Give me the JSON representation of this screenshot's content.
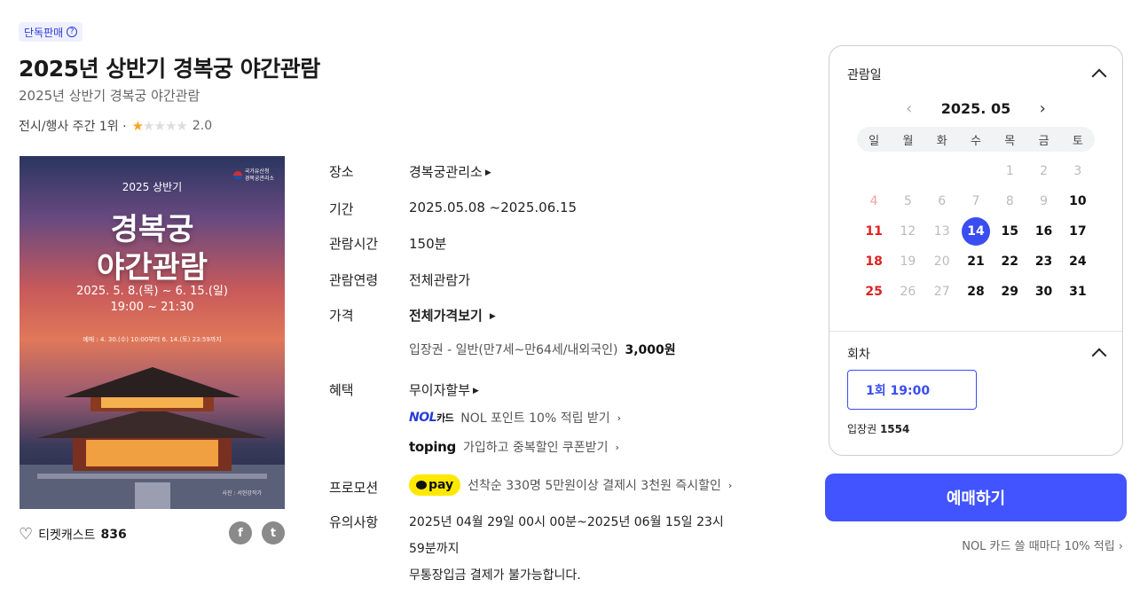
{
  "header": {
    "badge": "단독판매",
    "title": "2025년 상반기 경복궁 야간관람",
    "subtitle": "2025년 상반기 경복궁 야간관람",
    "rank_text": "전시/행사 주간 1위 ·",
    "rating": "2.0"
  },
  "poster": {
    "org_line1": "국가유산청",
    "org_line2": "경복궁관리소",
    "year": "2025 상반기",
    "title_line1": "경복궁",
    "title_line2": "야간관람",
    "date_line": "2025. 5. 8.(목) ~ 6. 15.(일)",
    "time_line": "19:00 ~ 21:30",
    "note": "예매 : 4. 30.(수) 10:00부터 6. 14.(토) 23:59까지",
    "credit": "사진 : 서헌강작가"
  },
  "cast": {
    "label": "티켓캐스트",
    "count": "836"
  },
  "info": {
    "venue_label": "장소",
    "venue": "경복궁관리소",
    "period_label": "기간",
    "period": "2025.05.08 ~2025.06.15",
    "runtime_label": "관람시간",
    "runtime": "150분",
    "age_label": "관람연령",
    "age": "전체관람가",
    "price_label": "가격",
    "price_link": "전체가격보기",
    "price_item": "입장권 - 일반(만7세~만64세/내외국인)",
    "price_value": "3,000원",
    "benefit_label": "혜택",
    "benefit_main": "무이자할부",
    "nol_card_logo": "NOL",
    "nol_card_logo_sub": "카드",
    "nol_card_text": "NOL 포인트 10% 적립 받기",
    "toping_logo": "toping",
    "toping_text": "가입하고 중복할인 쿠폰받기",
    "promo_label": "프로모션",
    "pay_logo": "pay",
    "promo_text": "선착순 330명 5만원이상 결제시 3천원 즉시할인",
    "notice_label": "유의사항",
    "notice_line1": "2025년 04월 29일 00시 00분~2025년 06월 15일 23시",
    "notice_line2": "59분까지",
    "notice_line3": "무통장입금 결제가 불가능합니다."
  },
  "booking": {
    "date_title": "관람일",
    "month": "2025. 05",
    "weekdays": [
      "일",
      "월",
      "화",
      "수",
      "목",
      "금",
      "토"
    ],
    "days": [
      {
        "t": "",
        "c": ""
      },
      {
        "t": "",
        "c": ""
      },
      {
        "t": "",
        "c": ""
      },
      {
        "t": "",
        "c": ""
      },
      {
        "t": "1",
        "c": "gray"
      },
      {
        "t": "2",
        "c": "gray"
      },
      {
        "t": "3",
        "c": "gray"
      },
      {
        "t": "4",
        "c": "redgray"
      },
      {
        "t": "5",
        "c": "gray"
      },
      {
        "t": "6",
        "c": "gray"
      },
      {
        "t": "7",
        "c": "gray"
      },
      {
        "t": "8",
        "c": "gray"
      },
      {
        "t": "9",
        "c": "gray"
      },
      {
        "t": "10",
        "c": ""
      },
      {
        "t": "11",
        "c": "red"
      },
      {
        "t": "12",
        "c": "gray"
      },
      {
        "t": "13",
        "c": "gray"
      },
      {
        "t": "14",
        "c": "sel"
      },
      {
        "t": "15",
        "c": ""
      },
      {
        "t": "16",
        "c": ""
      },
      {
        "t": "17",
        "c": ""
      },
      {
        "t": "18",
        "c": "red"
      },
      {
        "t": "19",
        "c": "gray"
      },
      {
        "t": "20",
        "c": "gray"
      },
      {
        "t": "21",
        "c": ""
      },
      {
        "t": "22",
        "c": ""
      },
      {
        "t": "23",
        "c": ""
      },
      {
        "t": "24",
        "c": ""
      },
      {
        "t": "25",
        "c": "red"
      },
      {
        "t": "26",
        "c": "gray"
      },
      {
        "t": "27",
        "c": "gray"
      },
      {
        "t": "28",
        "c": ""
      },
      {
        "t": "29",
        "c": ""
      },
      {
        "t": "30",
        "c": ""
      },
      {
        "t": "31",
        "c": ""
      }
    ],
    "round_title": "회차",
    "round_button": "1회  19:00",
    "seat_label": "입장권",
    "seat_count": "1554",
    "book_button": "예매하기",
    "nol_promo": "NOL 카드 쓸 때마다 10% 적립 ›"
  },
  "colors": {
    "accent": "#4154ff",
    "selected_day": "#3a4df0",
    "sunday": "#e02020",
    "star": "#f5a623",
    "kakaopay": "#ffe800"
  }
}
